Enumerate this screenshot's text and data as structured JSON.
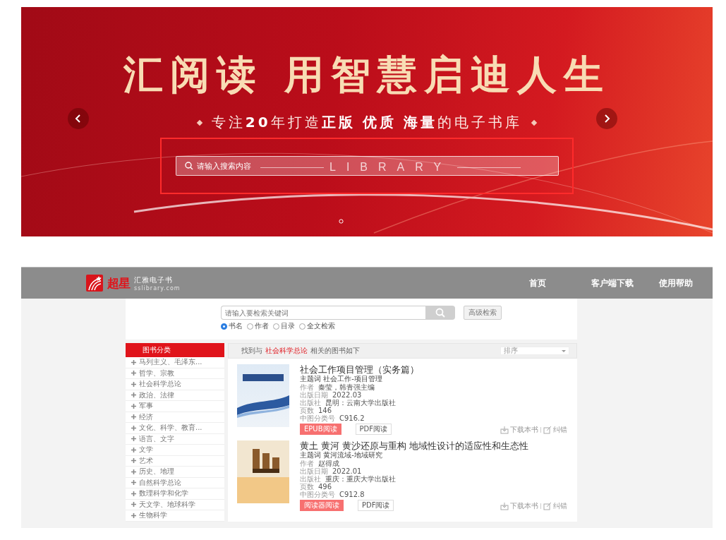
{
  "banner": {
    "headline": "汇阅读 用智慧启迪人生",
    "tagline": "专注**20**年打造**正版** **优质** **海量**的电子书库",
    "search": {
      "placeholder": "请输入搜索内容"
    },
    "overlay_text": "LIBRARY"
  },
  "header": {
    "logo_text": "超星",
    "brand": "汇雅电子书",
    "domain": "sslibrary.com",
    "nav": [
      "首页",
      "客户端下载",
      "使用帮助"
    ]
  },
  "search": {
    "placeholder": "请输入要检索关键词",
    "advanced_button": "高级检索",
    "options": [
      {
        "label": "书名",
        "selected": true
      },
      {
        "label": "作者",
        "selected": false
      },
      {
        "label": "目录",
        "selected": false
      },
      {
        "label": "全文检索",
        "selected": false
      }
    ]
  },
  "sidebar": {
    "title": "图书分类",
    "items": [
      "马列主义、毛泽东...",
      "哲学、宗教",
      "社会科学总论",
      "政治、法律",
      "军事",
      "经济",
      "文化、科学、教育...",
      "语言、文字",
      "文学",
      "艺术",
      "历史、地理",
      "自然科学总论",
      "数理科学和化学",
      "天文学、地球科学",
      "生物科学"
    ]
  },
  "results": {
    "summary_prefix": "找到与",
    "keyword": "社会科学总论",
    "summary_suffix": "相关的图书如下",
    "sort": {
      "placeholder": "排序"
    },
    "books": [
      {
        "title": "社会工作项目管理（实务篇）",
        "subject_label": "主题词",
        "subject": "社会工作-项目管理",
        "fields": [
          {
            "label": "作者",
            "value": "秦莹，韩青强主编"
          },
          {
            "label": "出版日期",
            "value": "2022.03"
          },
          {
            "label": "出版社",
            "value": "昆明：云南大学出版社"
          },
          {
            "label": "页数",
            "value": "146"
          },
          {
            "label": "中图分类号",
            "value": "C916.2"
          }
        ],
        "read_buttons": [
          {
            "label": "EPUB阅读",
            "kind": "primary"
          },
          {
            "label": "PDF阅读",
            "kind": "secondary"
          }
        ],
        "actions": [
          "下载本书",
          "纠错"
        ]
      },
      {
        "title": "黄土 黄河 黄沙还原与重构 地域性设计的适应性和生态性",
        "subject_label": "主题词",
        "subject": "黄河流域-地域研究",
        "fields": [
          {
            "label": "作者",
            "value": "赵得成"
          },
          {
            "label": "出版日期",
            "value": "2022.01"
          },
          {
            "label": "出版社",
            "value": "重庆：重庆大学出版社"
          },
          {
            "label": "页数",
            "value": "496"
          },
          {
            "label": "中图分类号",
            "value": "C912.8"
          }
        ],
        "read_buttons": [
          {
            "label": "阅读器阅读",
            "kind": "primary"
          },
          {
            "label": "PDF阅读",
            "kind": "secondary"
          }
        ],
        "actions": [
          "下载本书",
          "纠错"
        ]
      }
    ]
  }
}
